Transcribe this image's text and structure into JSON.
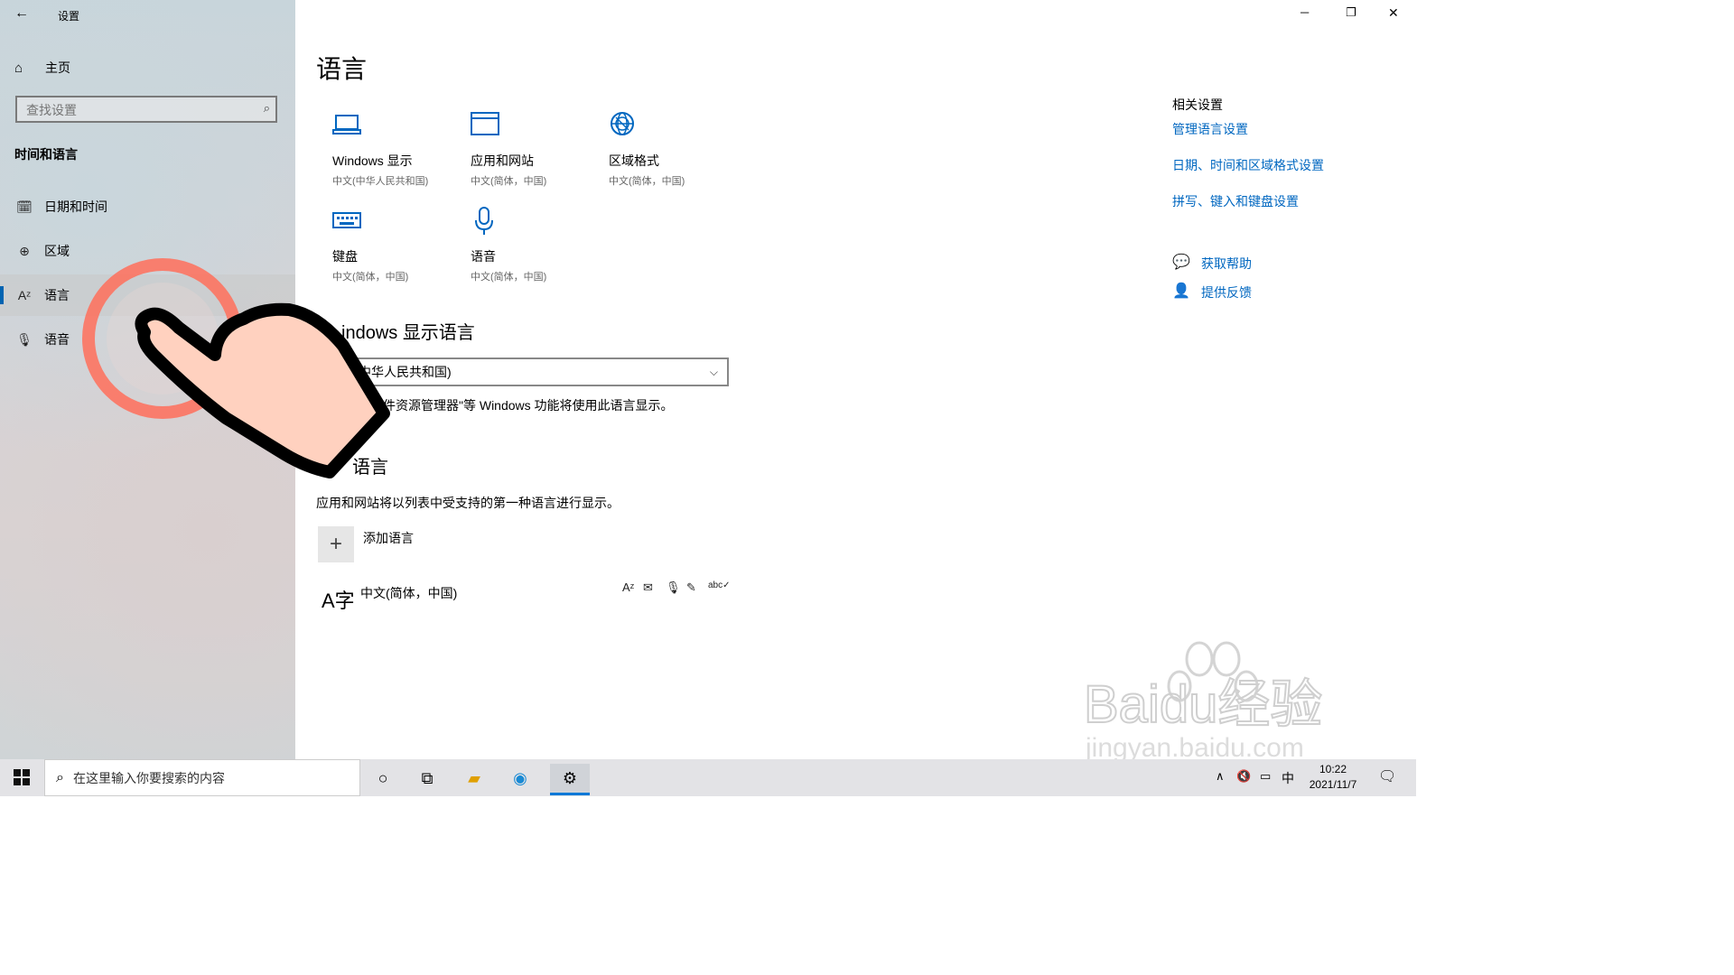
{
  "window": {
    "title": "设置",
    "back": "←",
    "minimize": "─",
    "restore": "❐",
    "close": "✕"
  },
  "sidebar": {
    "home": {
      "icon": "home-icon",
      "label": "主页"
    },
    "search_placeholder": "查找设置",
    "section": "时间和语言",
    "items": [
      {
        "icon": "calendar-clock-icon",
        "label": "日期和时间"
      },
      {
        "icon": "globe-region-icon",
        "label": "区域"
      },
      {
        "icon": "language-icon",
        "label": "语言",
        "selected": true
      },
      {
        "icon": "microphone-icon",
        "label": "语音"
      }
    ]
  },
  "main": {
    "title": "语言",
    "tiles": [
      {
        "icon": "laptop-icon",
        "title": "Windows 显示",
        "subtitle": "中文(中华人民共和国)"
      },
      {
        "icon": "browser-window-icon",
        "title": "应用和网站",
        "subtitle": "中文(简体，中国)"
      },
      {
        "icon": "globe-format-icon",
        "title": "区域格式",
        "subtitle": "中文(简体，中国)"
      },
      {
        "icon": "keyboard-icon",
        "title": "键盘",
        "subtitle": "中文(简体，中国)"
      },
      {
        "icon": "microphone-icon",
        "title": "语音",
        "subtitle": "中文(简体，中国)"
      }
    ],
    "display_language_heading": "indows 显示语言",
    "display_language_value": "中华人民共和国)",
    "display_language_note": "件资源管理器\"等 Windows 功能将使用此语言显示。",
    "preferred_heading": "语言",
    "preferred_note": "应用和网站将以列表中受支持的第一种语言进行显示。",
    "add_language": "添加语言",
    "installed_language": "中文(简体，中国)",
    "language_glyph": "A字",
    "feature_icons": [
      "language-pack-icon",
      "handwriting-icon",
      "speech-icon",
      "text-to-speech-icon",
      "spellcheck-icon"
    ]
  },
  "related": {
    "title": "相关设置",
    "links": [
      "管理语言设置",
      "日期、时间和区域格式设置",
      "拼写、键入和键盘设置"
    ],
    "help": {
      "icon": "help-chat-icon",
      "label": "获取帮助"
    },
    "feedback": {
      "icon": "feedback-person-icon",
      "label": "提供反馈"
    }
  },
  "taskbar": {
    "search_placeholder": "在这里输入你要搜索的内容",
    "time": "10:22",
    "date": "2021/11/7",
    "ime": "中",
    "tray_up": "∧",
    "volume": "🔇",
    "battery": "▭"
  },
  "watermark": {
    "text": "Baidu经验",
    "url": "jingyan.baidu.com"
  },
  "colors": {
    "accent": "#0067c0",
    "selection_bar": "#0063b1",
    "hand_fill": "#ffd1bf",
    "ring": "#ff6f5a"
  }
}
